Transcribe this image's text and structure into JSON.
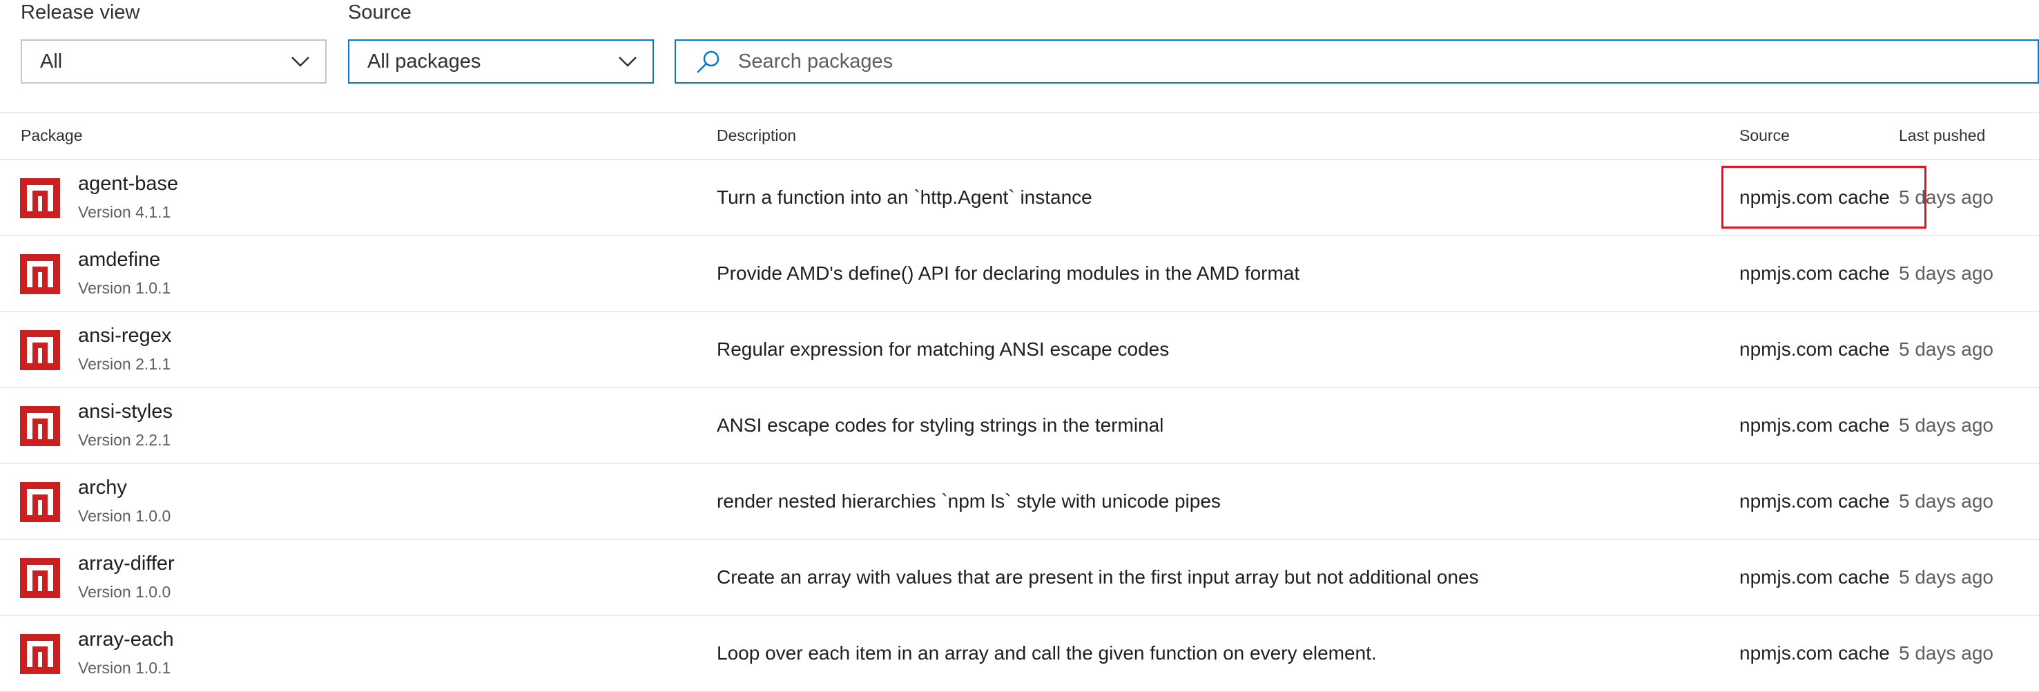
{
  "filters": {
    "release_view": {
      "label": "Release view",
      "value": "All"
    },
    "source": {
      "label": "Source",
      "value": "All packages"
    },
    "search": {
      "placeholder": "Search packages"
    }
  },
  "columns": {
    "package": "Package",
    "description": "Description",
    "source": "Source",
    "last_pushed": "Last pushed"
  },
  "colors": {
    "npm_red": "#cc1f1f",
    "accent": "#0078d4",
    "highlight": "#e81123"
  },
  "packages": [
    {
      "name": "agent-base",
      "version": "Version 4.1.1",
      "description": "Turn a function into an `http.Agent` instance",
      "source": "npmjs.com cache",
      "last_pushed": "5 days ago",
      "icon": "npm-icon"
    },
    {
      "name": "amdefine",
      "version": "Version 1.0.1",
      "description": "Provide AMD's define() API for declaring modules in the AMD format",
      "source": "npmjs.com cache",
      "last_pushed": "5 days ago",
      "icon": "npm-icon"
    },
    {
      "name": "ansi-regex",
      "version": "Version 2.1.1",
      "description": "Regular expression for matching ANSI escape codes",
      "source": "npmjs.com cache",
      "last_pushed": "5 days ago",
      "icon": "npm-icon"
    },
    {
      "name": "ansi-styles",
      "version": "Version 2.2.1",
      "description": "ANSI escape codes for styling strings in the terminal",
      "source": "npmjs.com cache",
      "last_pushed": "5 days ago",
      "icon": "npm-icon"
    },
    {
      "name": "archy",
      "version": "Version 1.0.0",
      "description": "render nested hierarchies `npm ls` style with unicode pipes",
      "source": "npmjs.com cache",
      "last_pushed": "5 days ago",
      "icon": "npm-icon"
    },
    {
      "name": "array-differ",
      "version": "Version 1.0.0",
      "description": "Create an array with values that are present in the first input array but not additional ones",
      "source": "npmjs.com cache",
      "last_pushed": "5 days ago",
      "icon": "npm-icon"
    },
    {
      "name": "array-each",
      "version": "Version 1.0.1",
      "description": "Loop over each item in an array and call the given function on every element.",
      "source": "npmjs.com cache",
      "last_pushed": "5 days ago",
      "icon": "npm-icon"
    }
  ]
}
